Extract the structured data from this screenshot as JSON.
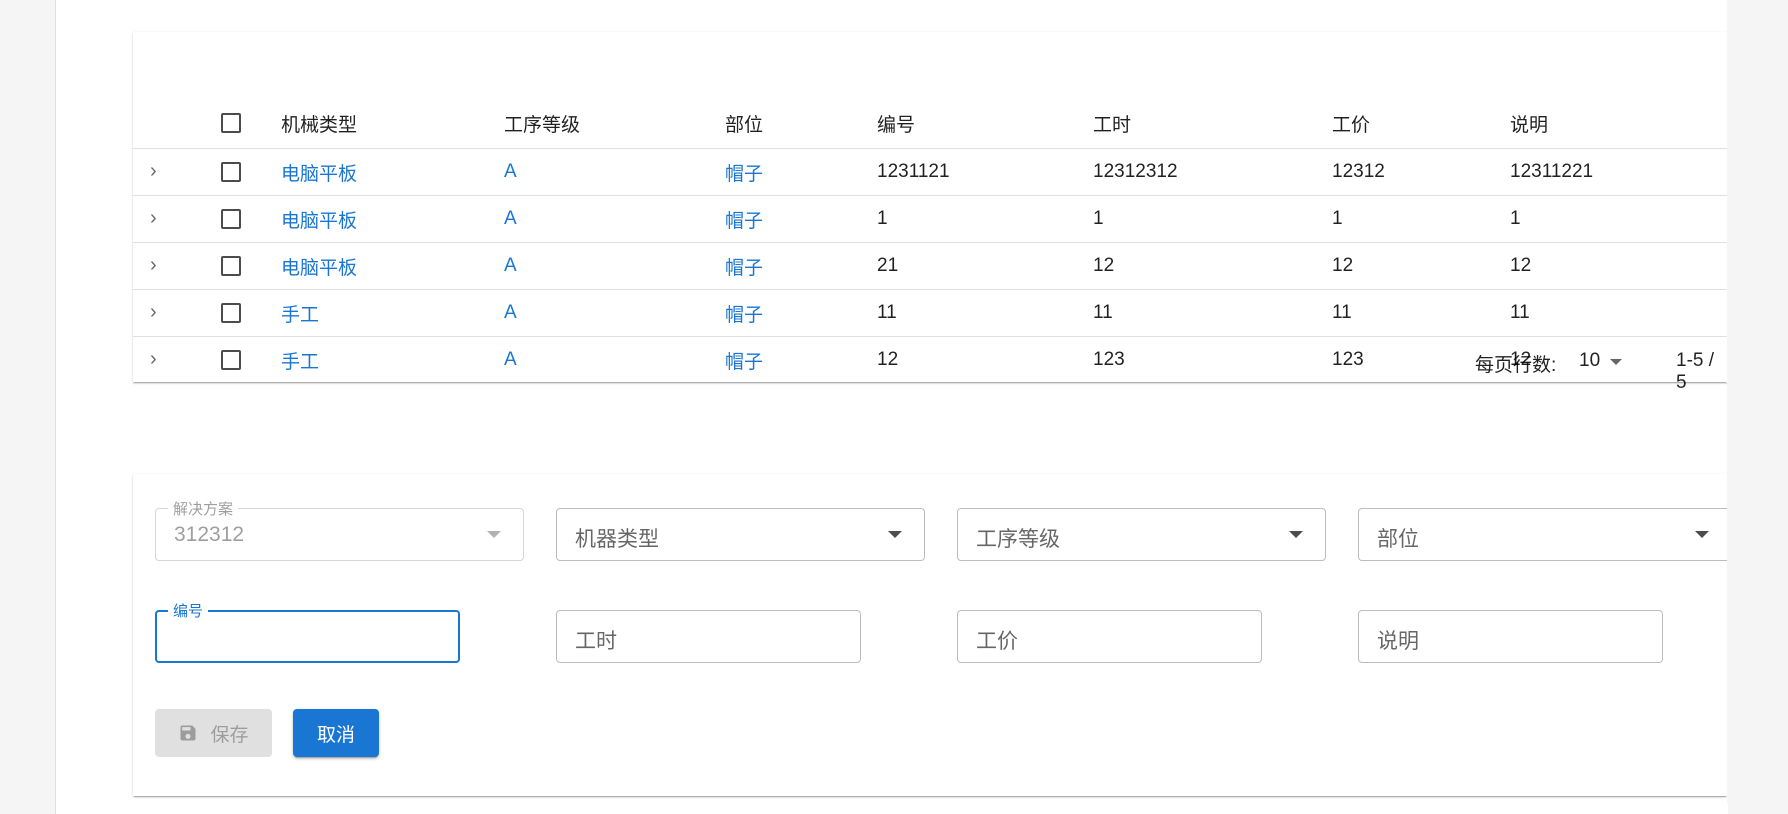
{
  "table": {
    "headers": [
      "机械类型",
      "工序等级",
      "部位",
      "编号",
      "工时",
      "工价",
      "说明"
    ],
    "rows": [
      {
        "type": "电脑平板",
        "level": "A",
        "part": "帽子",
        "code": "1231121",
        "hours": "12312312",
        "price": "12312",
        "desc": "12311221"
      },
      {
        "type": "电脑平板",
        "level": "A",
        "part": "帽子",
        "code": "1",
        "hours": "1",
        "price": "1",
        "desc": "1"
      },
      {
        "type": "电脑平板",
        "level": "A",
        "part": "帽子",
        "code": "21",
        "hours": "12",
        "price": "12",
        "desc": "12"
      },
      {
        "type": "手工",
        "level": "A",
        "part": "帽子",
        "code": "11",
        "hours": "11",
        "price": "11",
        "desc": "11"
      },
      {
        "type": "手工",
        "level": "A",
        "part": "帽子",
        "code": "12",
        "hours": "123",
        "price": "123",
        "desc": "12"
      }
    ]
  },
  "pagination": {
    "rows_per_page_label": "每页行数:",
    "rows_per_page_value": "10",
    "range": "1-5 / 5"
  },
  "form": {
    "solution_label": "解决方案",
    "solution_value": "312312",
    "machine_type_placeholder": "机器类型",
    "process_level_placeholder": "工序等级",
    "part_placeholder": "部位",
    "code_label": "编号",
    "hours_placeholder": "工时",
    "price_placeholder": "工价",
    "desc_placeholder": "说明",
    "save_label": "保存",
    "cancel_label": "取消"
  },
  "colors": {
    "primary": "#1976d2",
    "link": "#1976d2",
    "disabled_button": "#e0e0e0"
  }
}
